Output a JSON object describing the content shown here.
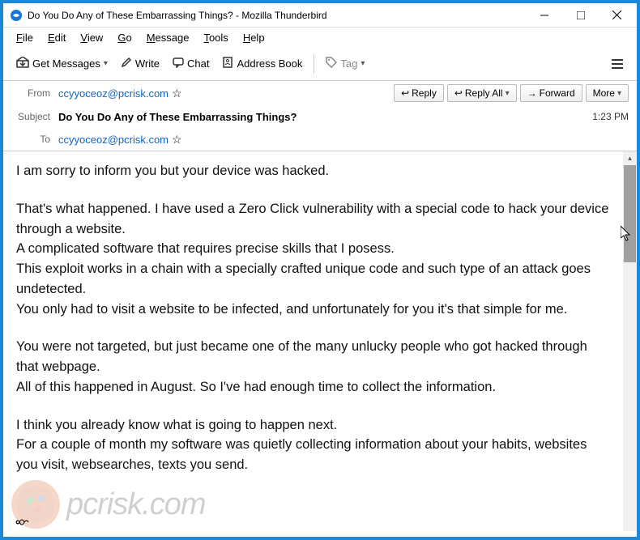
{
  "window": {
    "title": "Do You Do Any of These Embarrassing Things? - Mozilla Thunderbird"
  },
  "menubar": {
    "file": "File",
    "edit": "Edit",
    "view": "View",
    "go": "Go",
    "message": "Message",
    "tools": "Tools",
    "help": "Help"
  },
  "toolbar": {
    "get_messages": "Get Messages",
    "write": "Write",
    "chat": "Chat",
    "address_book": "Address Book",
    "tag": "Tag"
  },
  "headers": {
    "from_label": "From",
    "from_value": "ccyyoceoz@pcrisk.com",
    "subject_label": "Subject",
    "subject_value": "Do You Do Any of These Embarrassing Things?",
    "to_label": "To",
    "to_value": "ccyyoceoz@pcrisk.com",
    "time": "1:23 PM"
  },
  "actions": {
    "reply": "Reply",
    "reply_all": "Reply All",
    "forward": "Forward",
    "more": "More"
  },
  "body": {
    "p1": "I am sorry to inform you but your device was hacked.",
    "p2": "That's what happened. I have used a Zero Click vulnerability with a special code to hack your device through a website.\nA complicated software that requires precise skills that I posess.\nThis exploit works in a chain with a specially crafted unique code and such type of an attack goes undetected.\nYou only had to visit a website to be infected, and unfortunately for you it's that simple for me.",
    "p3": "You were not targeted, but just became one of the many unlucky people who got hacked through that webpage.\nAll of this happened in August. So I've had enough time to collect the information.",
    "p4": "I think you already know what is going to happen next.\nFor a couple of month my software was quietly collecting information about your habits, websites you visit, websearches, texts you send."
  },
  "watermark": {
    "text": "pcrisk.com"
  }
}
